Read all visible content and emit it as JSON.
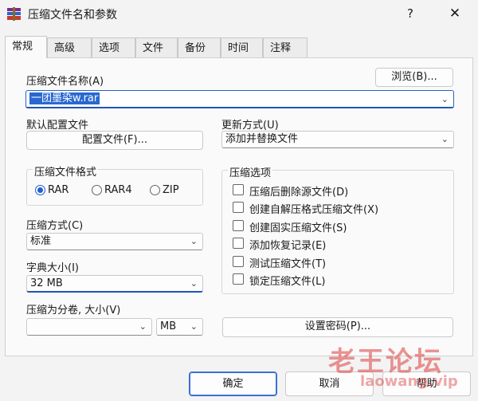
{
  "window": {
    "title": "压缩文件名和参数",
    "help_glyph": "?",
    "close_glyph": "✕",
    "icon": "winrar-icon"
  },
  "tabs": [
    "常规",
    "高级",
    "选项",
    "文件",
    "备份",
    "时间",
    "注释"
  ],
  "active_tab": "常规",
  "archive_name": {
    "label": "压缩文件名称(A)",
    "value": "一团墨染w.rar",
    "browse_label": "浏览(B)..."
  },
  "profile": {
    "label": "默认配置文件",
    "button_label": "配置文件(F)..."
  },
  "update_mode": {
    "label": "更新方式(U)",
    "value": "添加并替换文件"
  },
  "archive_format": {
    "label": "压缩文件格式",
    "options": [
      "RAR",
      "RAR4",
      "ZIP"
    ],
    "selected": "RAR"
  },
  "compression_method": {
    "label": "压缩方式(C)",
    "value": "标准"
  },
  "dictionary_size": {
    "label": "字典大小(I)",
    "value": "32 MB"
  },
  "split_volumes": {
    "label": "压缩为分卷, 大小(V)",
    "value": "",
    "unit": "MB"
  },
  "archive_options": {
    "label": "压缩选项",
    "items": [
      {
        "label": "压缩后删除源文件(D)",
        "checked": false
      },
      {
        "label": "创建自解压格式压缩文件(X)",
        "checked": false
      },
      {
        "label": "创建固实压缩文件(S)",
        "checked": false
      },
      {
        "label": "添加恢复记录(E)",
        "checked": false
      },
      {
        "label": "测试压缩文件(T)",
        "checked": false
      },
      {
        "label": "锁定压缩文件(L)",
        "checked": false
      }
    ]
  },
  "set_password_label": "设置密码(P)...",
  "buttons": {
    "ok": "确定",
    "cancel": "取消",
    "help": "帮助"
  },
  "watermark": {
    "text": "老王论坛",
    "url": "laowang.vip"
  },
  "colors": {
    "accent": "#1f5fd0",
    "selection": "#2a68d0",
    "background": "#f3f3f3",
    "watermark": "#dc3c3c"
  }
}
